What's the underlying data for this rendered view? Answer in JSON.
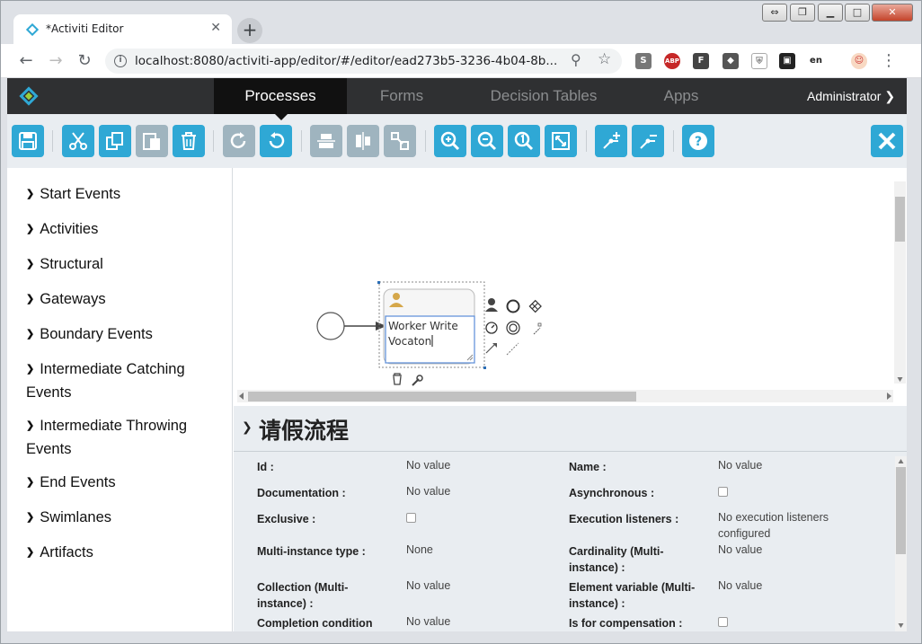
{
  "browser": {
    "tab_title": "*Activiti Editor",
    "tab_close": "✕",
    "new_tab": "+",
    "url": "localhost:8080/activiti-app/editor/#/editor/ead273b5-3236-4b04-8b...",
    "extensions": [
      "S",
      "ABP",
      "F",
      "◆",
      "⛨",
      "▣",
      "en",
      "☺"
    ]
  },
  "navbar": {
    "tabs": [
      "Processes",
      "Forms",
      "Decision Tables",
      "Apps"
    ],
    "active_tab": "Processes",
    "user": "Administrator ❯"
  },
  "palette": {
    "arrow": "❯",
    "items": [
      "Start Events",
      "Activities",
      "Structural",
      "Gateways",
      "Boundary Events",
      "Intermediate Catching Events",
      "Intermediate Throwing Events",
      "End Events",
      "Swimlanes",
      "Artifacts"
    ]
  },
  "diagram": {
    "task_text_line1": "Worker Write",
    "task_text_line2": "Vocaton"
  },
  "properties": {
    "title": "请假流程",
    "rows": [
      {
        "label": "Id :",
        "value": "No value"
      },
      {
        "label": "Name :",
        "value": "No value"
      },
      {
        "label": "Documentation :",
        "value": "No value"
      },
      {
        "label": "Asynchronous :",
        "value": ""
      },
      {
        "label": "Exclusive :",
        "value": ""
      },
      {
        "label": "Execution listeners :",
        "value": "No execution listeners configured"
      },
      {
        "label": "Multi-instance type :",
        "value": "None"
      },
      {
        "label": "Cardinality (Multi-instance) :",
        "value": "No value"
      },
      {
        "label": "Collection (Multi-instance) :",
        "value": "No value"
      },
      {
        "label": "Element variable (Multi-instance) :",
        "value": "No value"
      },
      {
        "label": "Completion condition",
        "value": "No value"
      },
      {
        "label": "Is for compensation :",
        "value": ""
      }
    ]
  },
  "colors": {
    "accent": "#2fa8d5",
    "navbar_bg": "#2f3032",
    "panel_bg": "#e9edf1"
  }
}
